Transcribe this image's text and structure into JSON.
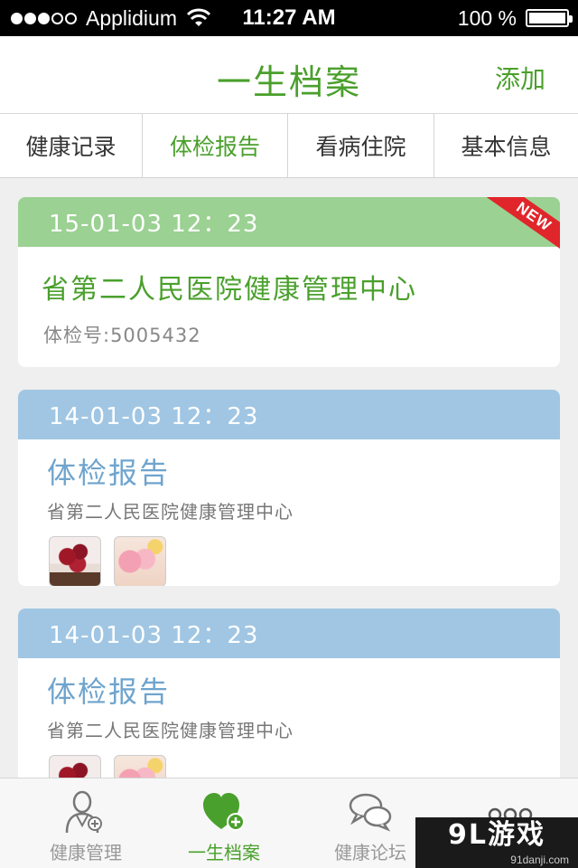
{
  "status_bar": {
    "carrier": "Applidium",
    "time": "11:27 AM",
    "battery": "100 %",
    "signal_bars_on": 3,
    "signal_bars_total": 5
  },
  "nav": {
    "title": "一生档案",
    "add_label": "添加"
  },
  "tabs": [
    {
      "label": "健康记录"
    },
    {
      "label": "体检报告",
      "active": true
    },
    {
      "label": "看病住院"
    },
    {
      "label": "基本信息"
    }
  ],
  "records": [
    {
      "datetime": "15-01-03 12：23",
      "badge": "NEW",
      "hospital": "省第二人民医院健康管理中心",
      "exam_no": "体检号:5005432"
    },
    {
      "datetime": "14-01-03 12：23",
      "title": "体检报告",
      "hospital": "省第二人民医院健康管理中心",
      "thumbnails": [
        "cake-photo",
        "candy-photo"
      ]
    },
    {
      "datetime": "14-01-03 12：23",
      "title": "体检报告",
      "hospital": "省第二人民医院健康管理中心",
      "thumbnails": [
        "cake-photo",
        "candy-photo"
      ]
    }
  ],
  "tab_bar": [
    {
      "label": "健康管理",
      "icon": "doctor-icon"
    },
    {
      "label": "一生档案",
      "icon": "heart-add-icon",
      "active": true
    },
    {
      "label": "健康论坛",
      "icon": "chat-bubbles-icon"
    },
    {
      "label": "",
      "icon": "more-dots-icon"
    }
  ],
  "watermark": {
    "logo": "9L游戏",
    "url": "91danji.com"
  },
  "colors": {
    "accent_green": "#4aa02c",
    "card_head_green": "#9bd192",
    "card_head_blue": "#a0c6e3",
    "title_blue": "#6fa4cd",
    "new_badge_red": "#e0262b"
  }
}
